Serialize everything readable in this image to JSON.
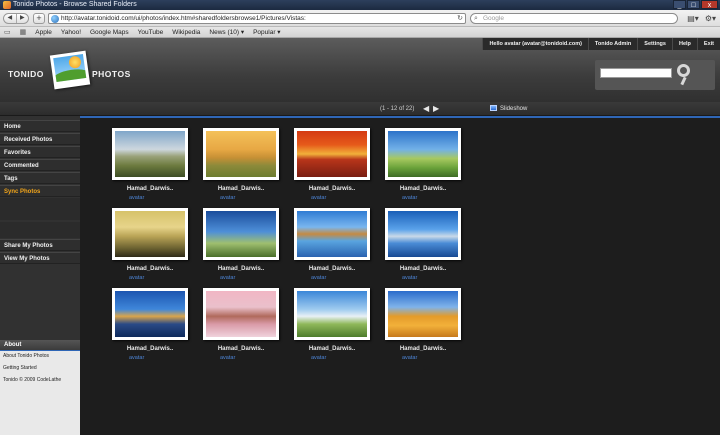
{
  "window": {
    "title": "Tonido Photos - Browse Shared Folders",
    "buttons": [
      "_",
      "□",
      "x"
    ]
  },
  "browser": {
    "url": "http://avatar.tonidoid.com/ui/photos/index.htm#sharedfoldersbrowse1/Pictures/Vistas:",
    "search_placeholder": "Google",
    "bookmarks": [
      "Apple",
      "Yahoo!",
      "Google Maps",
      "YouTube",
      "Wikipedia",
      "News (10) ▾",
      "Popular ▾"
    ]
  },
  "app": {
    "brand_left": "TONIDO",
    "brand_right": "PHOTOS",
    "topnav": [
      "Hello avatar (avatar@tonidoid.com)",
      "Tonido Admin",
      "Settings",
      "Help",
      "Exit"
    ]
  },
  "pager": {
    "text": "(1 - 12 of 22)",
    "slideshow": "Slideshow"
  },
  "sidebar": {
    "items": [
      "Home",
      "Received Photos",
      "Favorites",
      "Commented",
      "Tags",
      "Sync Photos"
    ],
    "active": "Sync Photos",
    "share_items": [
      "Share My Photos",
      "View My Photos"
    ],
    "about_title": "About",
    "about_links": [
      "About Tonido Photos",
      "Getting Started",
      "Tonido © 2009 CodeLathe"
    ]
  },
  "photos": [
    {
      "caption": "Hamad_Darwis..",
      "owner": "avatar"
    },
    {
      "caption": "Hamad_Darwis..",
      "owner": "avatar"
    },
    {
      "caption": "Hamad_Darwis..",
      "owner": "avatar"
    },
    {
      "caption": "Hamad_Darwis..",
      "owner": "avatar"
    },
    {
      "caption": "Hamad_Darwis..",
      "owner": "avatar"
    },
    {
      "caption": "Hamad_Darwis..",
      "owner": "avatar"
    },
    {
      "caption": "Hamad_Darwis..",
      "owner": "avatar"
    },
    {
      "caption": "Hamad_Darwis..",
      "owner": "avatar"
    },
    {
      "caption": "Hamad_Darwis..",
      "owner": "avatar"
    },
    {
      "caption": "Hamad_Darwis..",
      "owner": "avatar"
    },
    {
      "caption": "Hamad_Darwis..",
      "owner": "avatar"
    },
    {
      "caption": "Hamad_Darwis..",
      "owner": "avatar"
    }
  ]
}
